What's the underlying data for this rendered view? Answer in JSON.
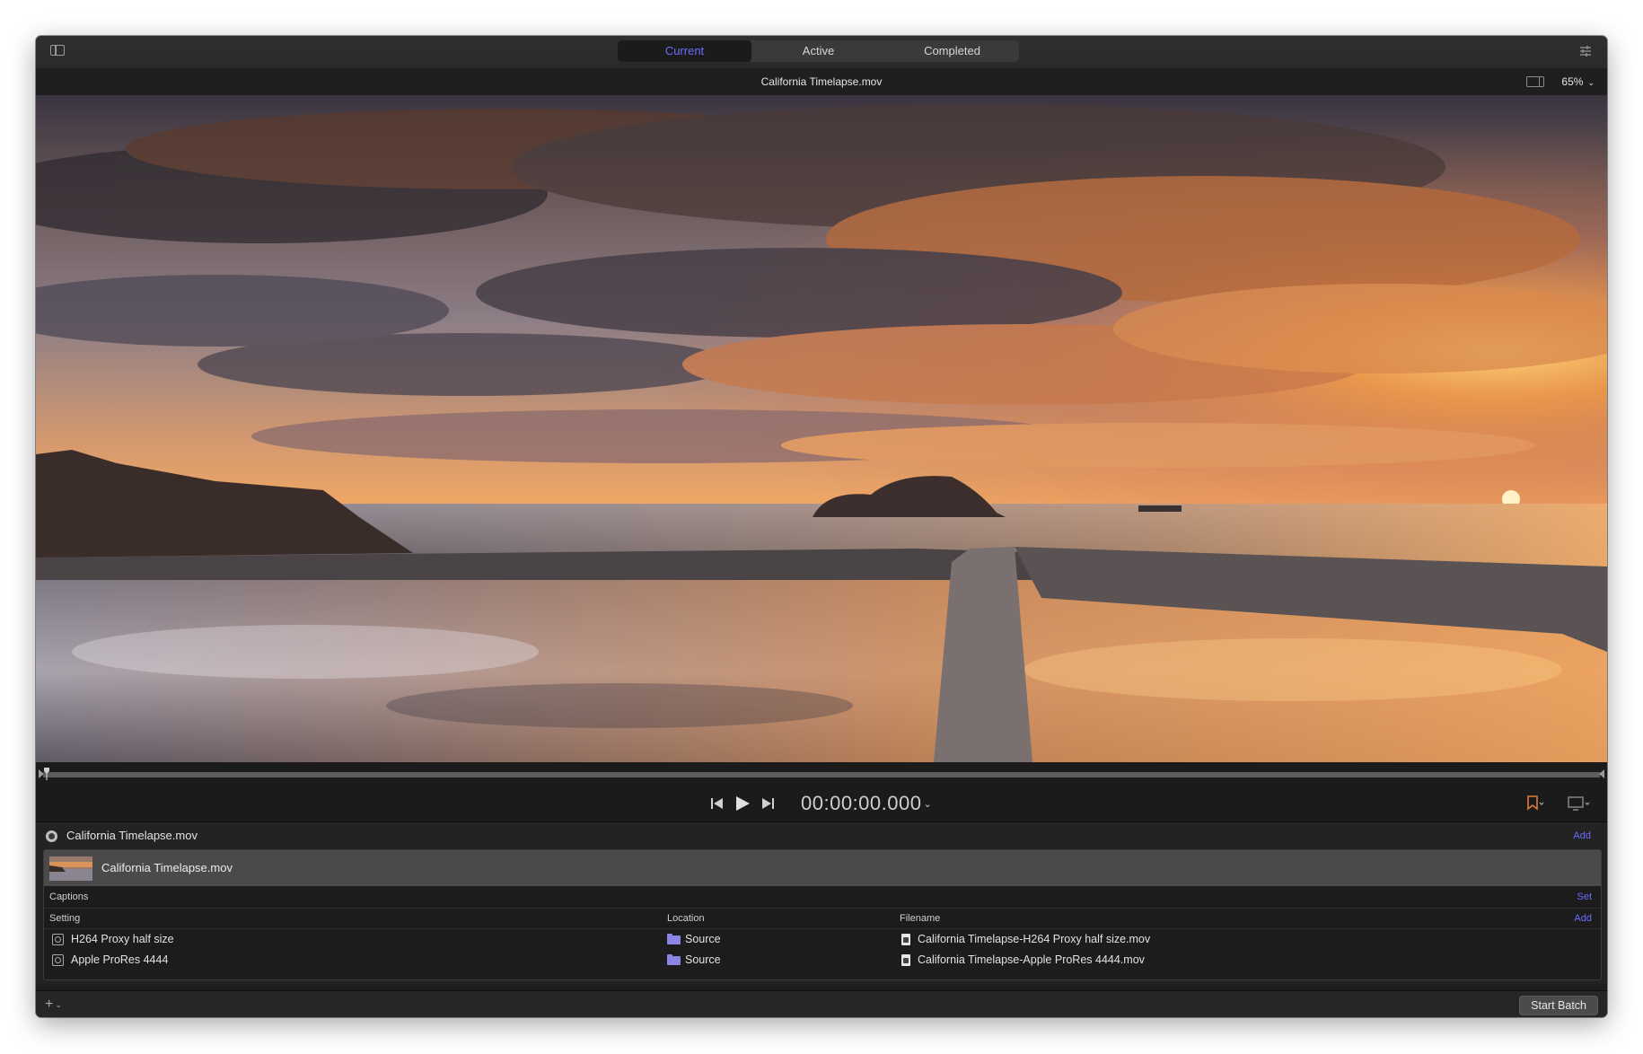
{
  "toolbar": {
    "tabs": [
      {
        "label": "Current"
      },
      {
        "label": "Active"
      },
      {
        "label": "Completed"
      }
    ]
  },
  "viewer": {
    "file_title": "California Timelapse.mov",
    "zoom": "65%"
  },
  "transport": {
    "timecode": "00:00:00.000"
  },
  "batch": {
    "job_name": "California Timelapse.mov",
    "add_label": "Add",
    "source_name": "California Timelapse.mov",
    "captions_label": "Captions",
    "captions_action": "Set",
    "columns": {
      "setting": "Setting",
      "location": "Location",
      "filename": "Filename",
      "add": "Add"
    },
    "outputs": [
      {
        "setting": "H264 Proxy half size",
        "location": "Source",
        "filename": "California Timelapse-H264 Proxy half size.mov"
      },
      {
        "setting": "Apple ProRes 4444",
        "location": "Source",
        "filename": "California Timelapse-Apple ProRes 4444.mov"
      }
    ]
  },
  "bottombar": {
    "add_symbol": "+",
    "start_batch": "Start Batch"
  },
  "colors": {
    "accent": "#6d6bff",
    "folder": "#8b85e6"
  }
}
